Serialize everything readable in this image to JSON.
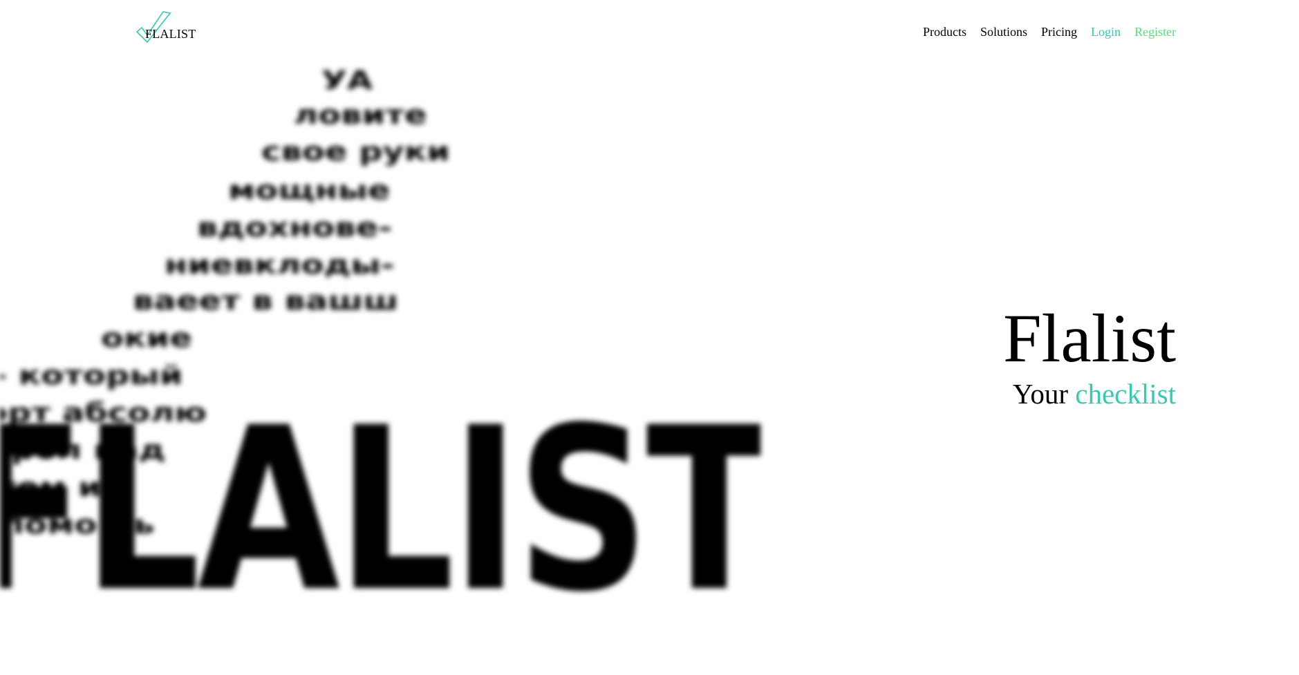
{
  "header": {
    "logo_text": "FLALIST",
    "logo_icon": "checkmark-icon",
    "nav": {
      "products": "Products",
      "solutions": "Solutions",
      "pricing": "Pricing",
      "login": "Login",
      "register": "Register"
    }
  },
  "colors": {
    "accent_teal": "#33cbb1",
    "accent_green": "#57e07a",
    "text": "#000000",
    "background": "#ffffff"
  },
  "background_art": {
    "lines": [
      "УА",
      "ловите",
      "свое руки",
      "мощные",
      "вдохнове-",
      "ниевклоды-",
      "ваеет в вашш",
      "окие",
      "- который",
      "орт абсолю",
      "трол над",
      "том их",
      "помощь"
    ],
    "big_word": "FLALIST"
  },
  "hero": {
    "title": "Flalist",
    "subtitle_prefix": "Your",
    "subtitle_accent": "checklist"
  }
}
